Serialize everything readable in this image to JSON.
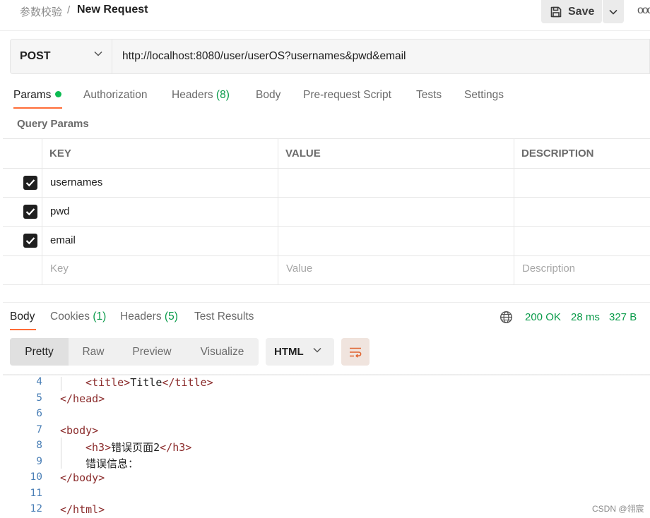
{
  "breadcrumb": {
    "parent": "参数校验",
    "separator": "/",
    "current": "New Request"
  },
  "toolbar": {
    "save_label": "Save",
    "more": "ooo"
  },
  "request": {
    "method": "POST",
    "url": "http://localhost:8080/user/userOS?usernames&pwd&email"
  },
  "request_tabs": {
    "params": "Params",
    "authorization": "Authorization",
    "headers": "Headers",
    "headers_count": "(8)",
    "body": "Body",
    "prerequest": "Pre-request Script",
    "tests": "Tests",
    "settings": "Settings"
  },
  "query_params": {
    "title": "Query Params",
    "columns": {
      "key": "KEY",
      "value": "VALUE",
      "description": "DESCRIPTION"
    },
    "rows": [
      {
        "key": "usernames",
        "checked": true
      },
      {
        "key": "pwd",
        "checked": true
      },
      {
        "key": "email",
        "checked": true
      }
    ],
    "placeholders": {
      "key": "Key",
      "value": "Value",
      "description": "Description"
    }
  },
  "response_tabs": {
    "body": "Body",
    "cookies": "Cookies",
    "cookies_count": "(1)",
    "headers": "Headers",
    "headers_count": "(5)",
    "test_results": "Test Results"
  },
  "status": {
    "code": "200 OK",
    "time": "28 ms",
    "size": "327 B"
  },
  "view": {
    "modes": [
      "Pretty",
      "Raw",
      "Preview",
      "Visualize"
    ],
    "active_mode": "Pretty",
    "format": "HTML"
  },
  "code_lines": [
    {
      "n": "4",
      "indent": 1,
      "open": "<title>",
      "text": "Title",
      "close": "</title>"
    },
    {
      "n": "5",
      "indent": 0,
      "open": "</head>",
      "text": "",
      "close": ""
    },
    {
      "n": "6",
      "indent": 0,
      "open": "",
      "text": "",
      "close": ""
    },
    {
      "n": "7",
      "indent": 0,
      "open": "<body>",
      "text": "",
      "close": ""
    },
    {
      "n": "8",
      "indent": 1,
      "open": "<h3>",
      "text": "错误页面2",
      "close": "</h3>"
    },
    {
      "n": "9",
      "indent": 1,
      "open": "",
      "text": "错误信息：",
      "close": ""
    },
    {
      "n": "10",
      "indent": 0,
      "open": "</body>",
      "text": "",
      "close": ""
    },
    {
      "n": "11",
      "indent": 0,
      "open": "",
      "text": "",
      "close": ""
    },
    {
      "n": "12",
      "indent": 0,
      "open": "</html>",
      "text": "",
      "close": ""
    }
  ],
  "watermark": "CSDN @翎宸",
  "colors": {
    "accent": "#ff6c37",
    "success": "#0a9b4a",
    "line_number": "#4a7fb6",
    "tag": "#8b2c2c"
  }
}
